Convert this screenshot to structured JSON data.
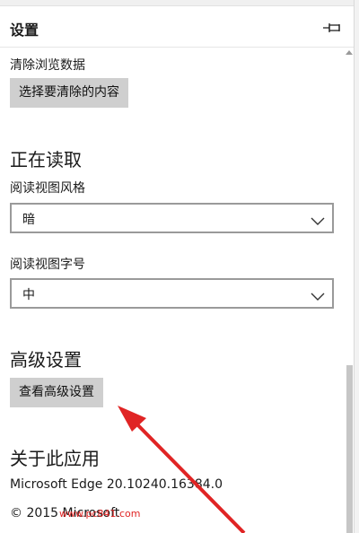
{
  "header": {
    "title": "设置",
    "pin_icon": "pin-icon"
  },
  "clear_data": {
    "label": "清除浏览数据",
    "button": "选择要清除的内容"
  },
  "reading": {
    "title": "正在读取",
    "style_label": "阅读视图风格",
    "style_value": "暗",
    "size_label": "阅读视图字号",
    "size_value": "中"
  },
  "advanced": {
    "title": "高级设置",
    "button": "查看高级设置"
  },
  "about": {
    "title": "关于此应用",
    "version": "Microsoft Edge 20.10240.16384.0",
    "copyright": "© 2015 Microsoft"
  },
  "watermark": "www.pc841.com",
  "colors": {
    "annotation_arrow": "#e02424",
    "button_bg": "#cfcfcf"
  }
}
